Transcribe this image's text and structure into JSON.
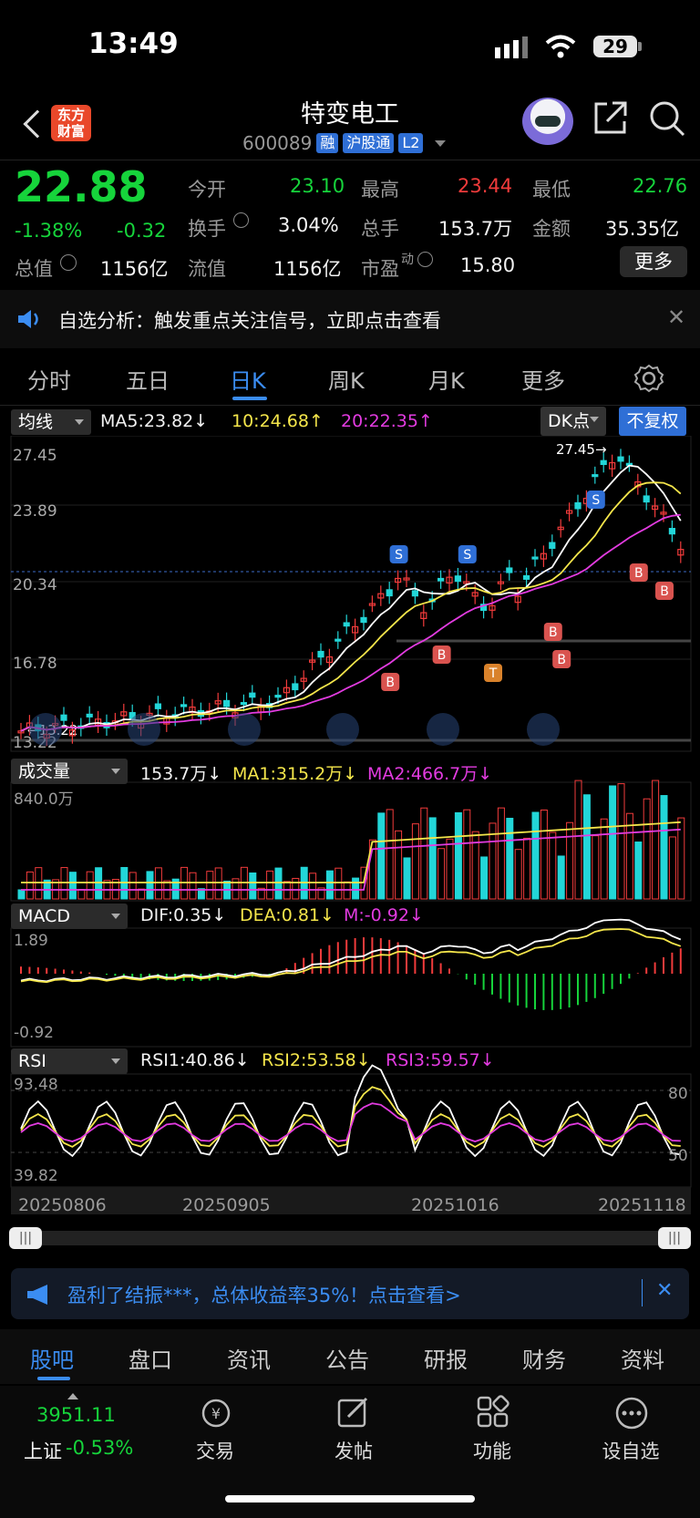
{
  "status": {
    "time": "13:49",
    "battery": "29"
  },
  "header": {
    "logo": [
      "东方",
      "财富"
    ],
    "name": "特变电工",
    "code": "600089",
    "tags": [
      "融",
      "沪股通",
      "L2"
    ]
  },
  "quote": {
    "price": "22.88",
    "change_pct": "-1.38%",
    "change": "-0.32",
    "open_label": "今开",
    "open": "23.10",
    "high_label": "最高",
    "high": "23.44",
    "low_label": "最低",
    "low": "22.76",
    "turnover_label": "换手",
    "turnover": "3.04%",
    "volume_label": "总手",
    "volume": "153.7万",
    "amount_label": "金额",
    "amount": "35.35亿",
    "mktcap_label": "总值",
    "mktcap": "1156亿",
    "float_label": "流值",
    "float": "1156亿",
    "pe_label": "市盈",
    "pe_sup": "动",
    "pe": "15.80",
    "more": "更多"
  },
  "notice": {
    "text": "自选分析：触发重点关注信号，立即点击查看"
  },
  "tabs": {
    "items": [
      "分时",
      "五日",
      "日K",
      "周K",
      "月K",
      "更多"
    ],
    "active": "日K"
  },
  "kline": {
    "selector": "均线",
    "ma5": "MA5:23.82↓",
    "ma10": "10:24.68↑",
    "ma20": "20:22.35↑",
    "dk": "DK点",
    "fq": "不复权",
    "y_labels": [
      "27.45",
      "23.89",
      "20.34",
      "16.78",
      "13.22"
    ],
    "max_label": "27.45",
    "min_label": "13.22"
  },
  "volume": {
    "selector": "成交量",
    "v": "153.7万↓",
    "ma1": "MA1:315.2万↓",
    "ma2": "MA2:466.7万↓",
    "y_top": "840.0万"
  },
  "macd": {
    "selector": "MACD",
    "dif": "DIF:0.35↓",
    "dea": "DEA:0.81↓",
    "m": "M:-0.92↓",
    "y_top": "1.89",
    "y_bot": "-0.92"
  },
  "rsi": {
    "selector": "RSI",
    "rsi1": "RSI1:40.86↓",
    "rsi2": "RSI2:53.58↓",
    "rsi3": "RSI3:59.57↓",
    "y_top": "93.48",
    "y_bot": "39.82",
    "l80": "80",
    "l50": "50"
  },
  "dates": [
    "20250806",
    "20250905",
    "20251016",
    "20251118"
  ],
  "ad": {
    "text": "盈利了结振***，总体收益率35%！点击查看>"
  },
  "bottom_tabs": {
    "items": [
      "股吧",
      "盘口",
      "资讯",
      "公告",
      "研报",
      "财务",
      "资料"
    ],
    "active": "股吧"
  },
  "footer": {
    "index_value": "3951.11",
    "index_name": "上证",
    "index_change": "-0.53%",
    "items": [
      "交易",
      "发帖",
      "功能",
      "设自选"
    ]
  },
  "colors": {
    "up": "#f23b3b",
    "down": "#16d43b",
    "accent": "#3b8df2",
    "ma5": "#ffffff",
    "ma10": "#f5e64b",
    "ma20": "#e23be0",
    "cyan_candle": "#22d6d8"
  }
}
